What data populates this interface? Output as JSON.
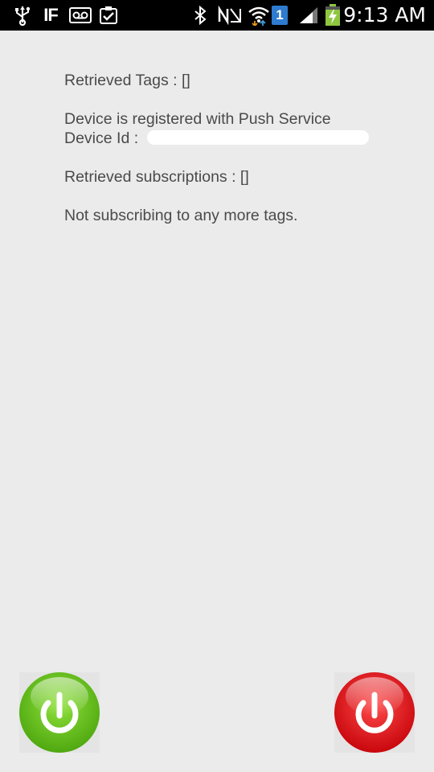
{
  "status_bar": {
    "time": "9:13 AM",
    "notification_icons": [
      "usb-icon",
      "flipboard-icon",
      "voicemail-icon",
      "clipboard-check-icon"
    ],
    "system_icons": [
      "bluetooth-icon",
      "nfc-muted-icon",
      "wifi-icon",
      "sim-one-icon",
      "signal-icon",
      "battery-charging-icon"
    ],
    "sim_label": "1",
    "flipboard_label": "IF"
  },
  "content": {
    "retrieved_tags": "Retrieved Tags : []",
    "registered": "Device is registered with Push Service",
    "device_id_label": "Device Id :",
    "retrieved_subscriptions": "Retrieved subscriptions : []",
    "not_subscribing": "Not subscribing to any more tags."
  },
  "buttons": {
    "subscribe_color": "#6cc11f",
    "unsubscribe_color": "#e8181f"
  }
}
